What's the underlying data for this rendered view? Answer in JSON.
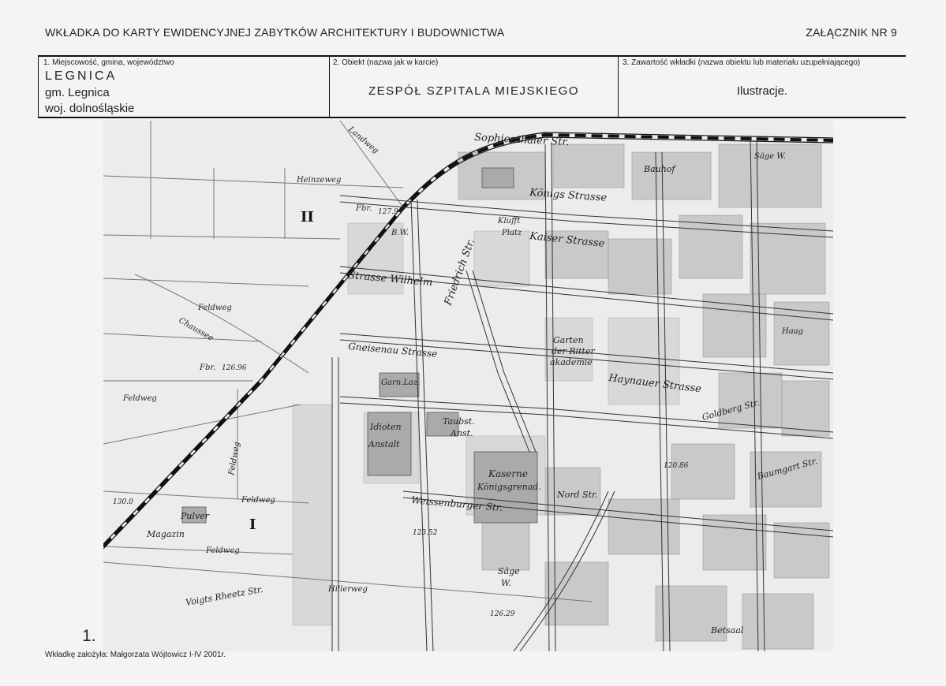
{
  "header": {
    "title": "WKŁADKA DO KARTY EWIDENCYJNEJ ZABYTKÓW ARCHITEKTURY I BUDOWNICTWA",
    "annex": "ZAŁĄCZNIK NR 9"
  },
  "fields": {
    "location": {
      "label": "1. Miejscowość, gmina, województwo",
      "town": "LEGNICA",
      "gmina": "gm. Legnica",
      "voivodeship": "woj. dolnośląskie"
    },
    "object": {
      "label": "2. Obiekt (nazwa jak w karcie)",
      "value": "ZESPÓŁ  SZPITALA  MIEJSKIEGO"
    },
    "content": {
      "label": "3. Zawartość wkładki (nazwa obiektu lub materiału uzupełniającego)",
      "value": "Ilustracje."
    }
  },
  "map": {
    "labels": {
      "zone1": "I",
      "zone2": "II",
      "sophienthaler": "Sophienthaler Str.",
      "konig": "Königs Strasse",
      "kaiser": "Kaiser Strasse",
      "wilhelm": "Strasse Wilhelm",
      "friedrich": "Friedrich Str.",
      "gneisenau": "Gneisenau Strasse",
      "haynauer": "Haynauer Strasse",
      "weissenburger": "Weissenburger Str.",
      "nord": "Nord Str.",
      "feldweg1": "Feldweg",
      "feldweg2": "Feldweg",
      "feldweg3": "Feldweg",
      "feldweg4": "Feldweg",
      "feldweg5": "Feldweg",
      "heinzeweg": "Heinzeweg",
      "landweg": "Landweg",
      "chaussee": "Chaussee",
      "hillerweg": "Hillerweg",
      "voigts": "Voigts Rheetz Str.",
      "kasernei": "Kaserne",
      "kaserne2": "Königsgrenad.",
      "idioten1": "Idioten",
      "idioten2": "Anstalt",
      "taubst1": "Taubst.",
      "taubst2": "Anst.",
      "garnlaz": "Garn.Laz.",
      "garten1": "Garten",
      "garten2": "der Ritter",
      "garten3": "akademie",
      "pulver": "Pulver",
      "magazin": "Magazin",
      "sage1": "Säge W.",
      "sage2": "Säge",
      "sage3": "W.",
      "betsaal": "Betsaal",
      "bauhof": "Bauhof",
      "kluft1": "Klufft",
      "kluft2": "Platz",
      "haag": "Haag",
      "baumgart": "Baumgart Str.",
      "goldberg": "Goldberg Str.",
      "elev1": "130.0",
      "elev2": "127.94",
      "elev3": "126.96",
      "elev4": "120.86",
      "elev5": "126.29",
      "elev6": "123.52",
      "fbr1": "Fbr.",
      "fbr2": "Fbr.",
      "bw": "B.W."
    }
  },
  "footer": {
    "plate_number": "1.",
    "author": "Wkładkę założyła: Małgorzata Wójtowicz I-IV 2001r."
  }
}
